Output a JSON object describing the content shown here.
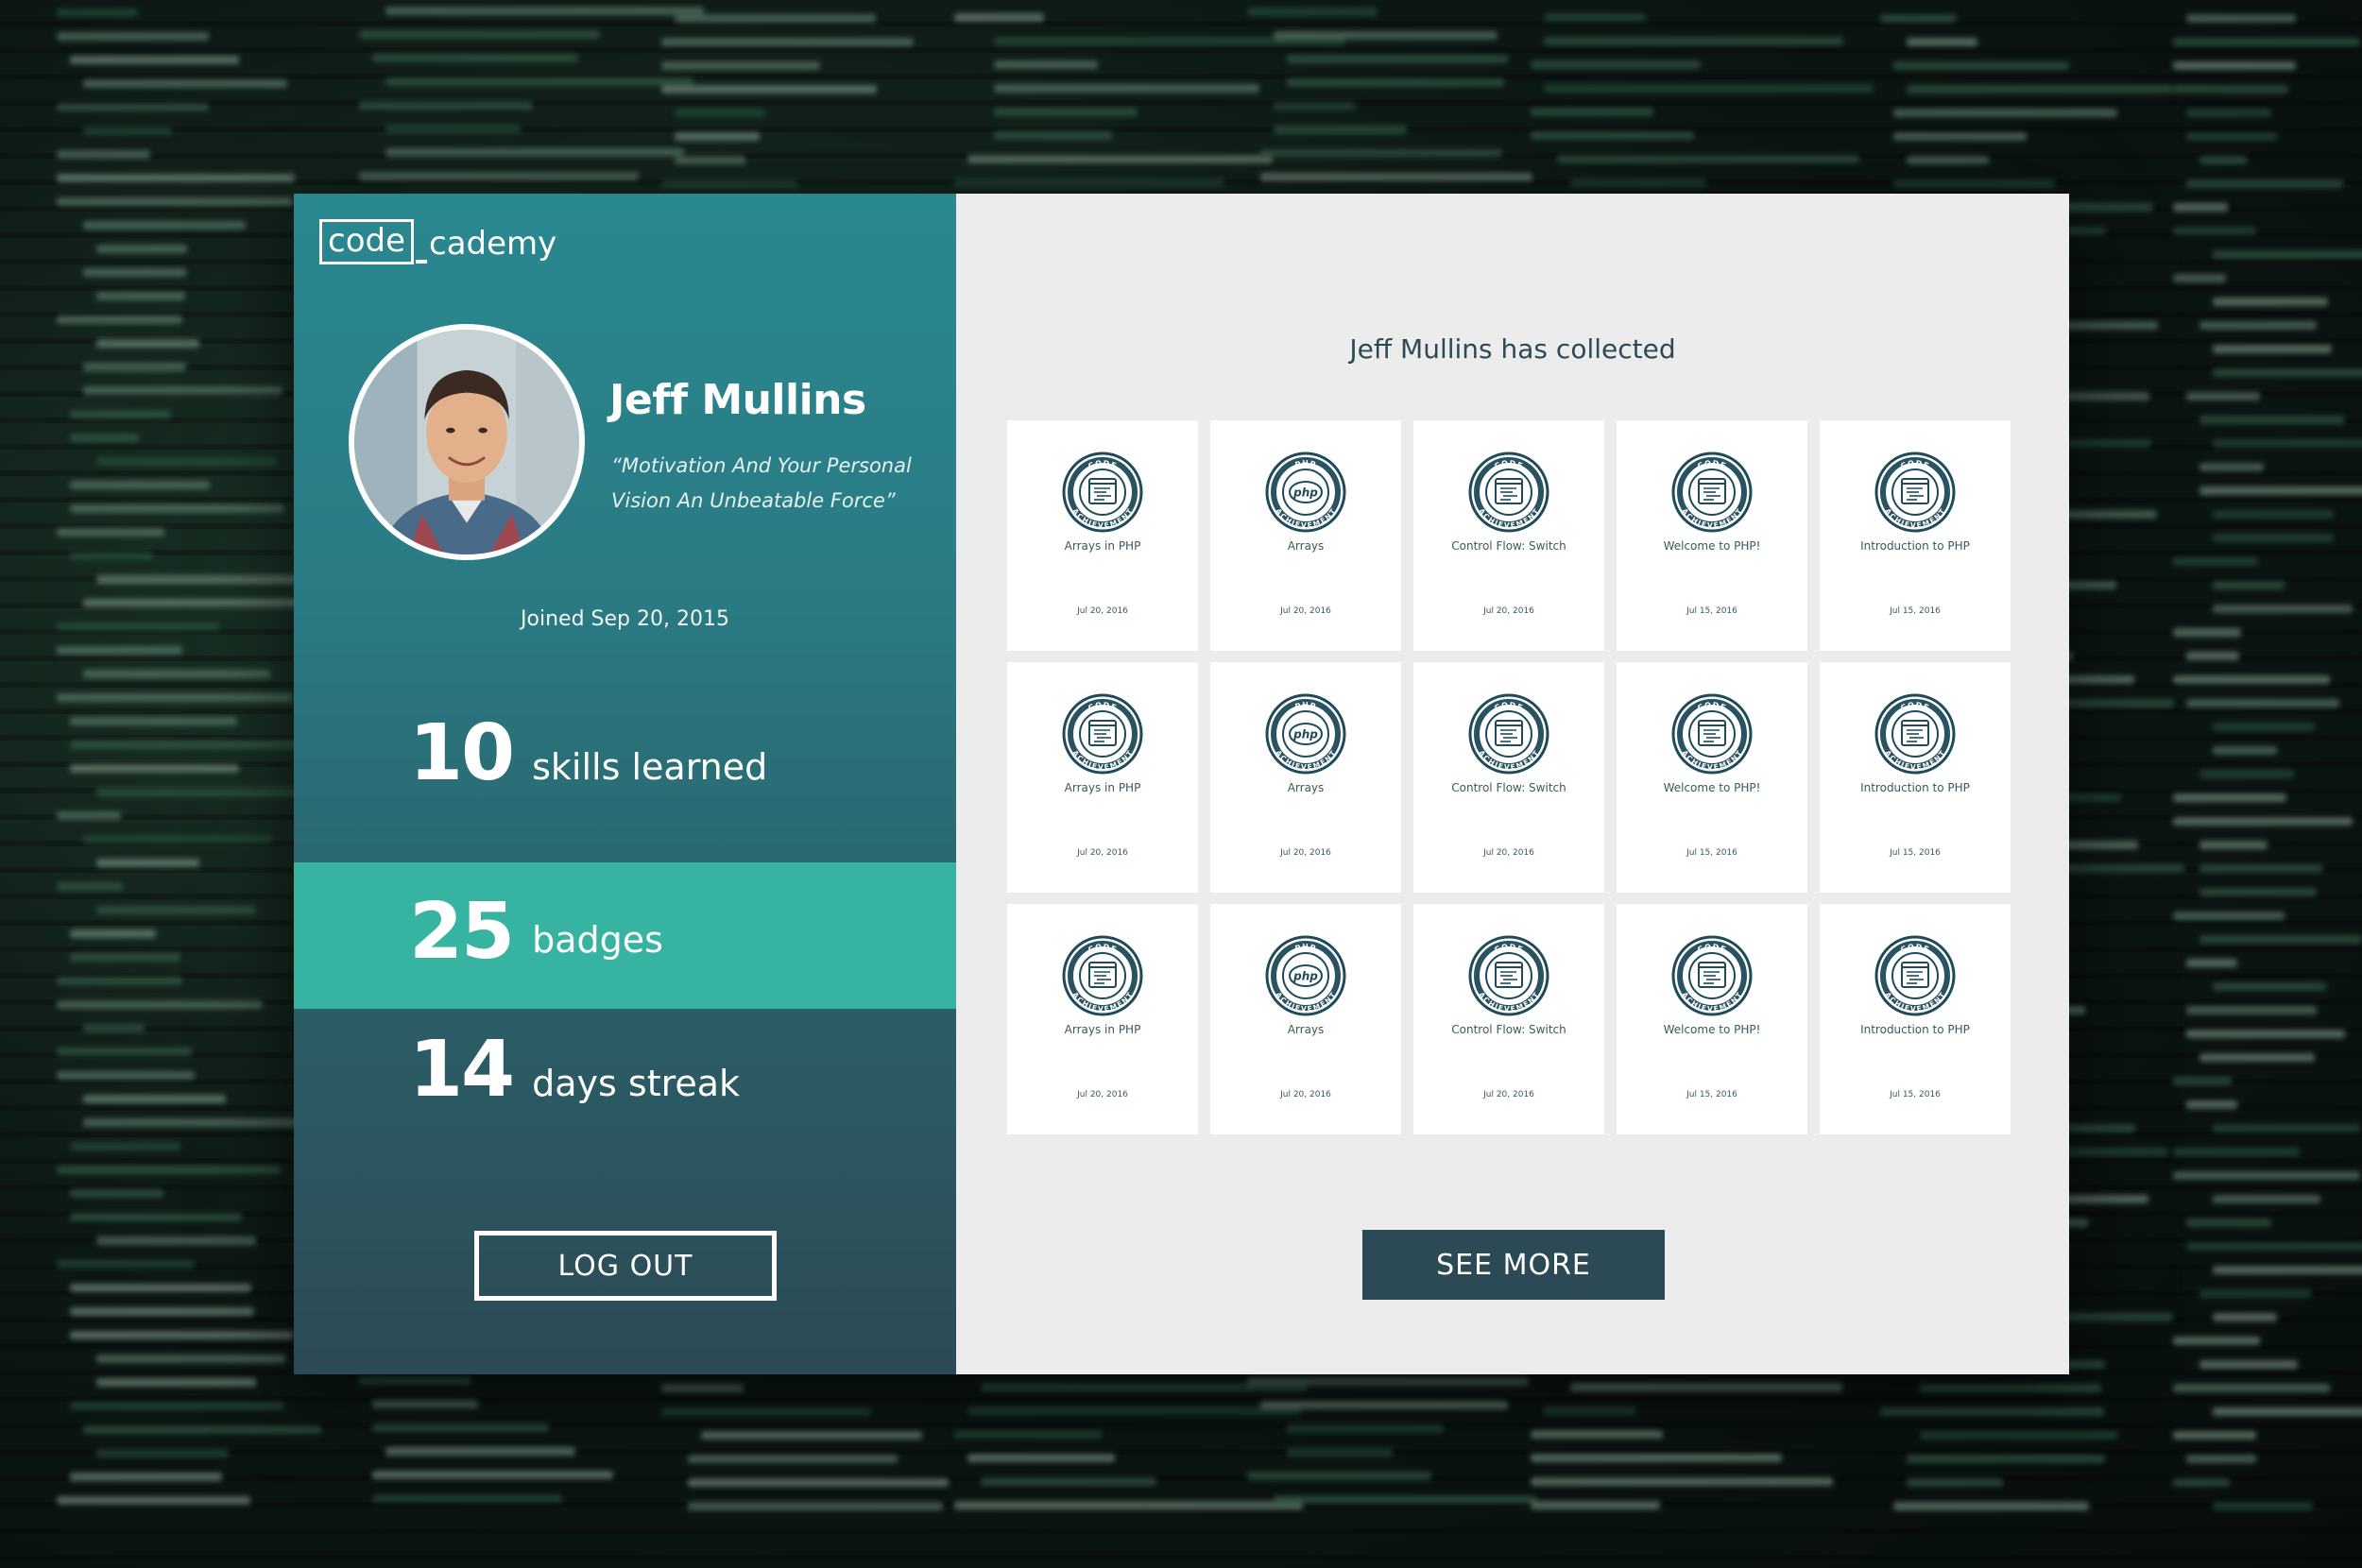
{
  "brand": {
    "logo_code": "code",
    "logo_rest": "cademy"
  },
  "profile": {
    "name": "Jeff Mullins",
    "motto": "“Motivation And Your Personal Vision An Unbeatable Force”",
    "joined": "Joined Sep 20, 2015"
  },
  "stats": {
    "skills": {
      "value": "10",
      "label": "skills learned"
    },
    "badges": {
      "value": "25",
      "label": "badges"
    },
    "streak": {
      "value": "14",
      "label": "days streak"
    }
  },
  "actions": {
    "logout_label": "LOG OUT",
    "see_more_label": "SEE MORE"
  },
  "collection": {
    "title": "Jeff Mullins has collected",
    "badges": [
      {
        "kind": "code",
        "title": "Arrays in PHP",
        "date": "Jul 20, 2016"
      },
      {
        "kind": "php",
        "title": "Arrays",
        "date": "Jul 20, 2016"
      },
      {
        "kind": "code",
        "title": "Control Flow: Switch",
        "date": "Jul 20, 2016"
      },
      {
        "kind": "code",
        "title": "Welcome to PHP!",
        "date": "Jul 15, 2016"
      },
      {
        "kind": "code",
        "title": "Introduction to PHP",
        "date": "Jul 15, 2016"
      },
      {
        "kind": "code",
        "title": "Arrays in PHP",
        "date": "Jul 20, 2016"
      },
      {
        "kind": "php",
        "title": "Arrays",
        "date": "Jul 20, 2016"
      },
      {
        "kind": "code",
        "title": "Control Flow: Switch",
        "date": "Jul 20, 2016"
      },
      {
        "kind": "code",
        "title": "Welcome to PHP!",
        "date": "Jul 15, 2016"
      },
      {
        "kind": "code",
        "title": "Introduction to PHP",
        "date": "Jul 15, 2016"
      },
      {
        "kind": "code",
        "title": "Arrays in PHP",
        "date": "Jul 20, 2016"
      },
      {
        "kind": "php",
        "title": "Arrays",
        "date": "Jul 20, 2016"
      },
      {
        "kind": "code",
        "title": "Control Flow: Switch",
        "date": "Jul 20, 2016"
      },
      {
        "kind": "code",
        "title": "Welcome to PHP!",
        "date": "Jul 15, 2016"
      },
      {
        "kind": "code",
        "title": "Introduction to PHP",
        "date": "Jul 15, 2016"
      }
    ],
    "badge_ring_text": {
      "code": {
        "top": "CODE",
        "bottom": "ACHIEVEMENT"
      },
      "php": {
        "top": "PHP",
        "bottom": "ACHIEVEMENT",
        "center": "php"
      }
    }
  },
  "colors": {
    "accent": "#36b4a1",
    "panel_dark": "#2c4a55",
    "panel_teal": "#2a8890",
    "badge_ink": "#1f4a5a",
    "right_bg": "#ececec"
  }
}
